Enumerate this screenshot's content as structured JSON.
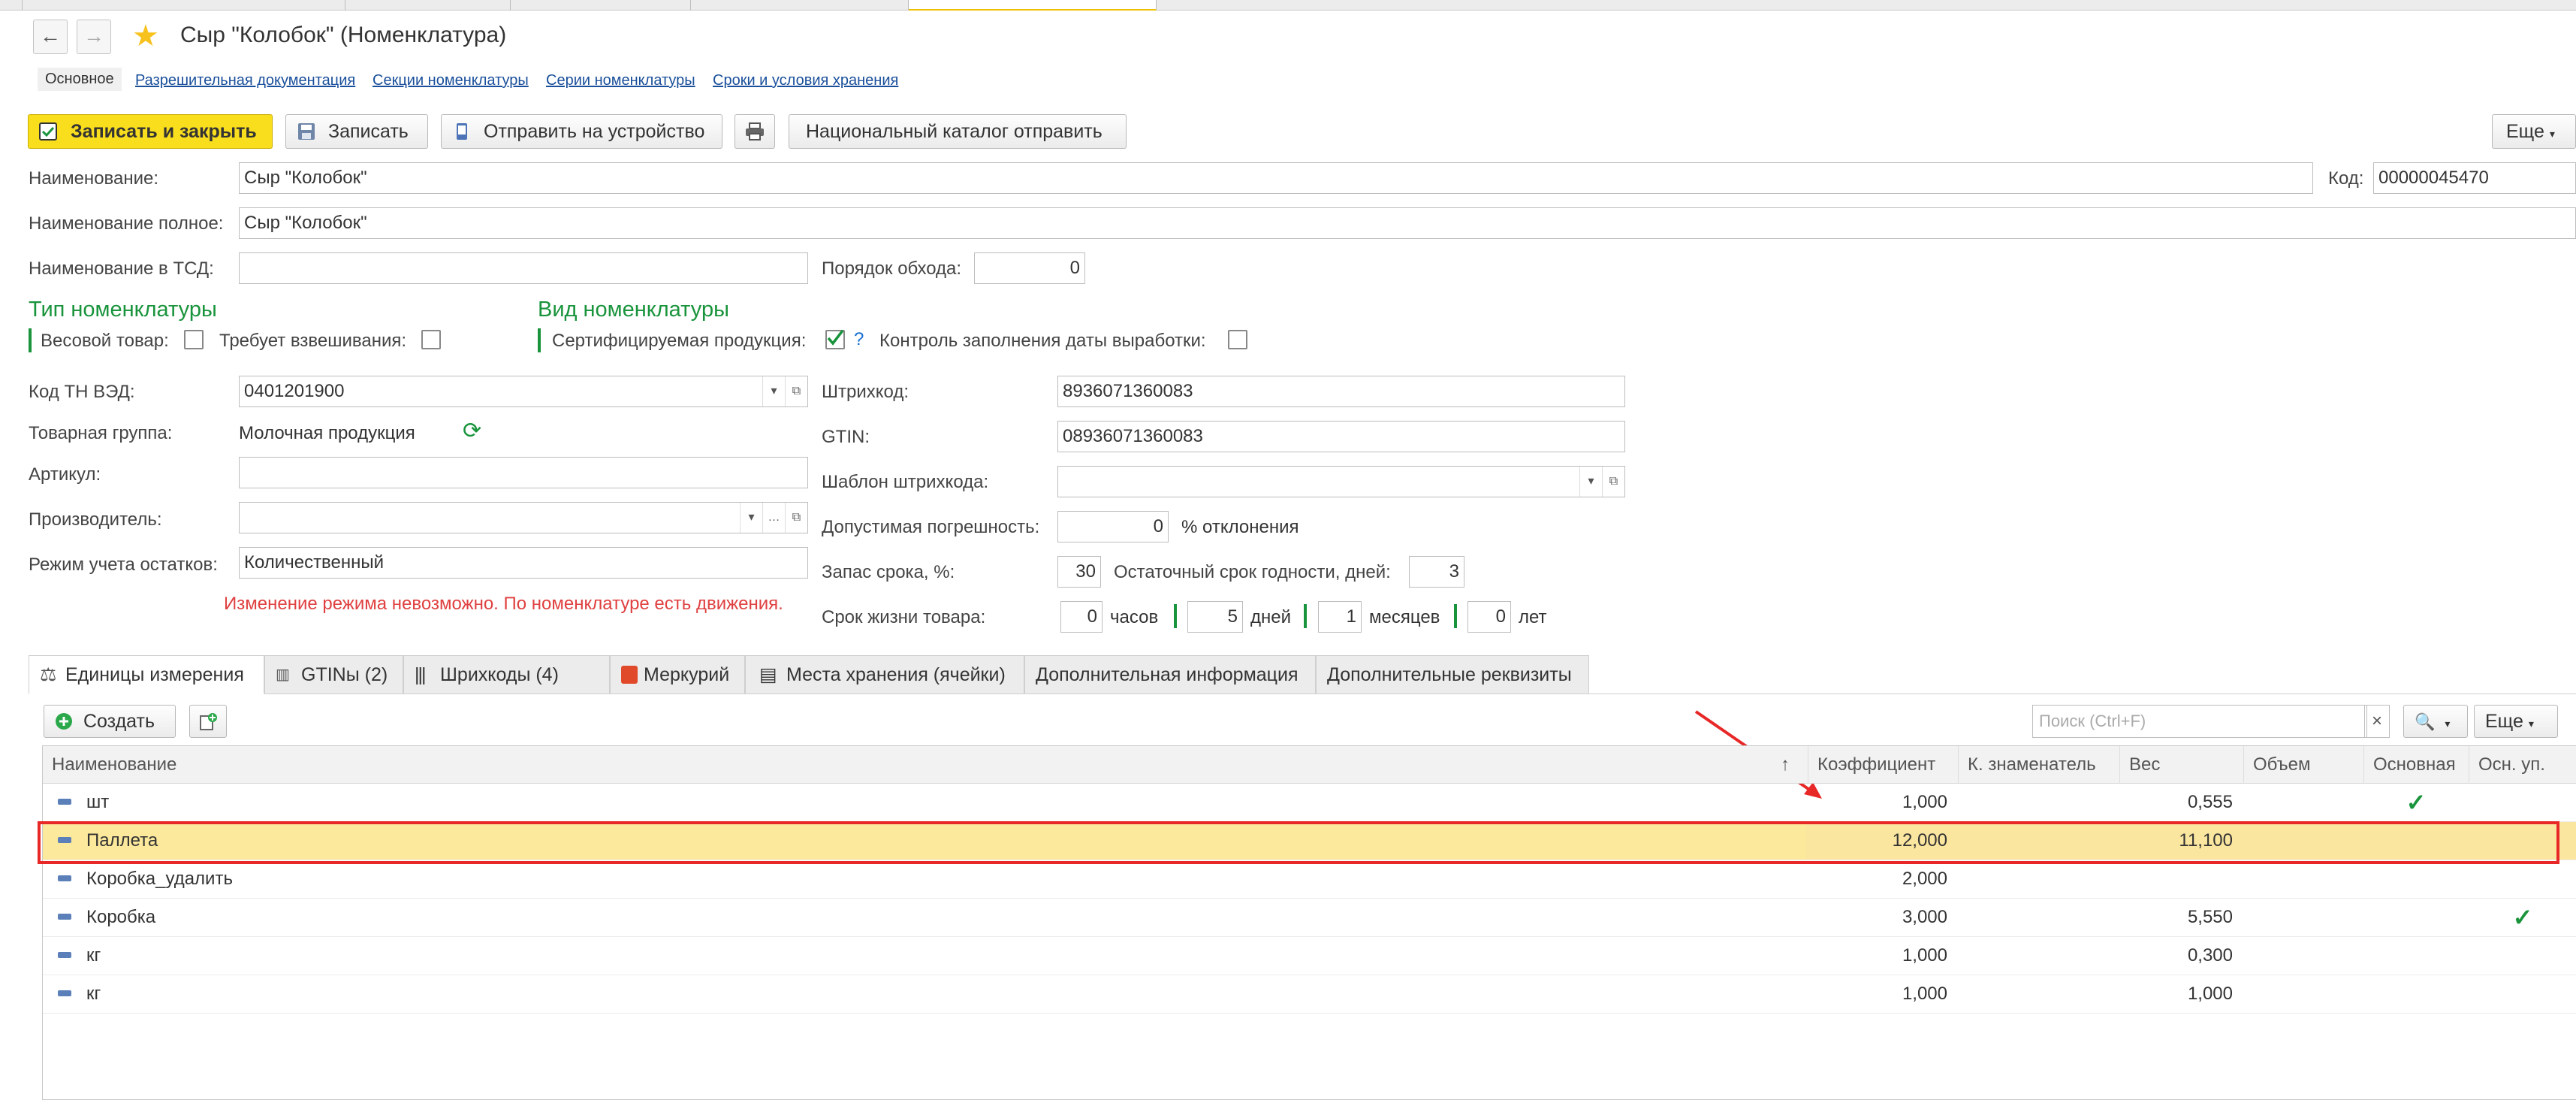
{
  "window": {
    "title": "Сыр \"Колобок\" (Номенклатура)"
  },
  "section_tabs": [
    "Основное",
    "Разрешительная документация",
    "Секции номенклатуры",
    "Серии номенклатуры",
    "Сроки и условия хранения"
  ],
  "toolbar": {
    "save_close": "Записать и закрыть",
    "save": "Записать",
    "send_device": "Отправить на устройство",
    "national_catalog": "Национальный каталог отправить",
    "more": "Еще"
  },
  "form": {
    "name_label": "Наименование:",
    "name_value": "Сыр \"Колобок\"",
    "code_label": "Код:",
    "code_value": "00000045470",
    "fullname_label": "Наименование полное:",
    "fullname_value": "Сыр \"Колобок\"",
    "tsd_label": "Наименование в ТСД:",
    "tsd_value": "",
    "order_label": "Порядок обхода:",
    "order_value": "0",
    "type_group": "Тип номенклатуры",
    "weight_label": "Весовой товар:",
    "requires_weigh_label": "Требует взвешивания:",
    "kind_group": "Вид номенклатуры",
    "certified_label": "Сертифицируемая продукция:",
    "help_mark": "?",
    "date_control_label": "Контроль заполнения даты выработки:",
    "tnved_label": "Код ТН ВЭД:",
    "tnved_value": "0401201900",
    "barcode_label": "Штрихкод:",
    "barcode_value": "8936071360083",
    "group_label": "Товарная группа:",
    "group_value": "Молочная продукция",
    "gtin_label": "GTIN:",
    "gtin_value": "08936071360083",
    "article_label": "Артикул:",
    "article_value": "",
    "barcode_template_label": "Шаблон штрихкода:",
    "producer_label": "Производитель:",
    "tolerance_label": "Допустимая погрешность:",
    "tolerance_value": "0",
    "tolerance_unit": "% отклонения",
    "mode_label": "Режим учета остатков:",
    "mode_value": "Количественный",
    "reserve_label": "Запас срока, %:",
    "reserve_value": "30",
    "residual_label": "Остаточный срок годности, дней:",
    "residual_value": "3",
    "error_text": "Изменение режима невозможно. По номенклатуре есть движения.",
    "life_label": "Срок жизни товара:",
    "hours_value": "0",
    "hours_unit": "часов",
    "days_value": "5",
    "days_unit": "дней",
    "months_value": "1",
    "months_unit": "месяцев",
    "years_value": "0",
    "years_unit": "лет"
  },
  "tabs": [
    "Единицы измерения",
    "GTINы (2)",
    "Шрихкоды (4)",
    "Меркурий",
    "Места хранения (ячейки)",
    "Дополнительная информация",
    "Дополнительные реквизиты"
  ],
  "units_toolbar": {
    "create": "Создать",
    "search_placeholder": "Поиск (Ctrl+F)",
    "search_clear": "×",
    "more": "Еще"
  },
  "table": {
    "columns": [
      "Наименование",
      "Коэффициент",
      "К. знаменатель",
      "Вес",
      "Объем",
      "Основная",
      "Осн. уп."
    ],
    "sort_mark": "↑",
    "check_mark": "✓",
    "rows": [
      {
        "name": "шт",
        "coef": "1,000",
        "denom": "",
        "weight": "0,555",
        "volume": "",
        "main": true,
        "main_pack": false
      },
      {
        "name": "Паллета",
        "coef": "12,000",
        "denom": "",
        "weight": "11,100",
        "volume": "",
        "main": false,
        "main_pack": false,
        "selected": true
      },
      {
        "name": "Коробка_удалить",
        "coef": "2,000",
        "denom": "",
        "weight": "",
        "volume": "",
        "main": false,
        "main_pack": false
      },
      {
        "name": "Коробка",
        "coef": "3,000",
        "denom": "",
        "weight": "5,550",
        "volume": "",
        "main": false,
        "main_pack": true
      },
      {
        "name": "кг",
        "coef": "1,000",
        "denom": "",
        "weight": "0,300",
        "volume": "",
        "main": false,
        "main_pack": false
      },
      {
        "name": "кг",
        "coef": "1,000",
        "denom": "",
        "weight": "1,000",
        "volume": "",
        "main": false,
        "main_pack": false
      }
    ]
  },
  "colors": {
    "accent": "#f9de1e",
    "group": "#19943c",
    "error": "#e04040",
    "selection": "#fce99c",
    "annotation": "#e82727"
  }
}
